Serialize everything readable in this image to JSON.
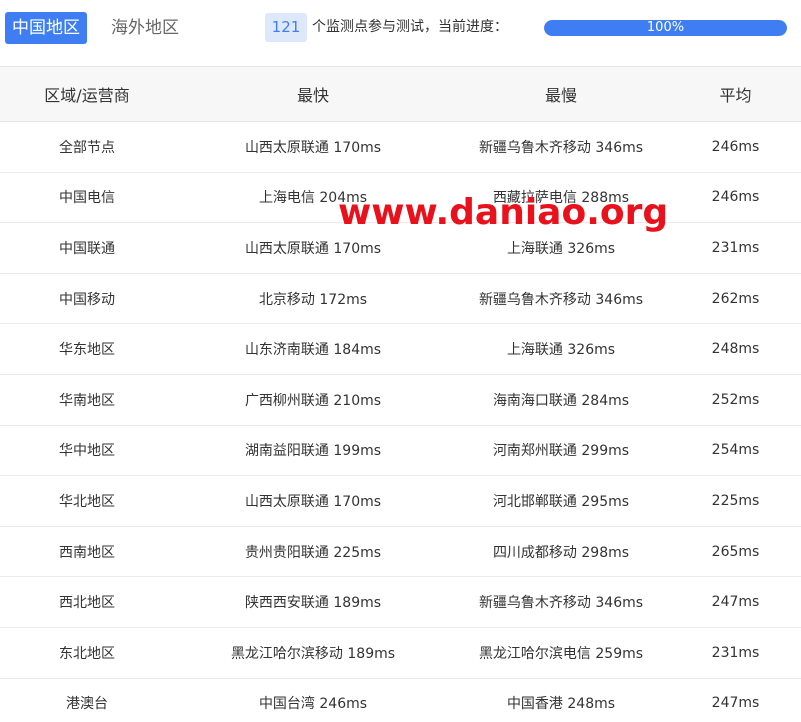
{
  "tabs": [
    {
      "label": "中国地区",
      "active": true
    },
    {
      "label": "海外地区",
      "active": false
    }
  ],
  "status": {
    "count": "121",
    "description": "个监测点参与测试，当前进度：",
    "progress_text": "100%",
    "progress_value": 100
  },
  "table": {
    "headers": [
      "区域/运营商",
      "最快",
      "最慢",
      "平均"
    ],
    "rows": [
      [
        "全部节点",
        "山西太原联通 170ms",
        "新疆乌鲁木齐移动 346ms",
        "246ms"
      ],
      [
        "中国电信",
        "上海电信 204ms",
        "西藏拉萨电信 288ms",
        "246ms"
      ],
      [
        "中国联通",
        "山西太原联通 170ms",
        "上海联通 326ms",
        "231ms"
      ],
      [
        "中国移动",
        "北京移动 172ms",
        "新疆乌鲁木齐移动 346ms",
        "262ms"
      ],
      [
        "华东地区",
        "山东济南联通 184ms",
        "上海联通 326ms",
        "248ms"
      ],
      [
        "华南地区",
        "广西柳州联通 210ms",
        "海南海口联通 284ms",
        "252ms"
      ],
      [
        "华中地区",
        "湖南益阳联通 199ms",
        "河南郑州联通 299ms",
        "254ms"
      ],
      [
        "华北地区",
        "山西太原联通 170ms",
        "河北邯郸联通 295ms",
        "225ms"
      ],
      [
        "西南地区",
        "贵州贵阳联通 225ms",
        "四川成都移动 298ms",
        "265ms"
      ],
      [
        "西北地区",
        "陕西西安联通 189ms",
        "新疆乌鲁木齐移动 346ms",
        "247ms"
      ],
      [
        "东北地区",
        "黑龙江哈尔滨移动 189ms",
        "黑龙江哈尔滨电信 259ms",
        "231ms"
      ],
      [
        "港澳台",
        "中国台湾 246ms",
        "中国香港 248ms",
        "247ms"
      ]
    ]
  },
  "watermark": "www.daniao.org",
  "colors": {
    "accent": "#3f7ef2",
    "watermark": "#e8111c"
  }
}
